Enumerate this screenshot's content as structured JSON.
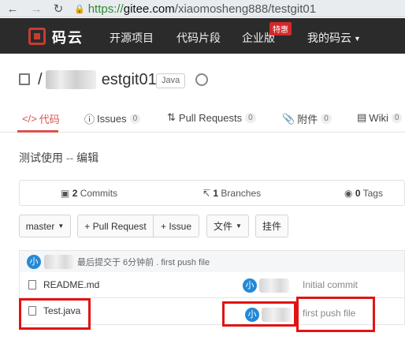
{
  "browser": {
    "url_secure": "https://",
    "url_host": "gitee.com",
    "url_path": "/xiaomosheng888/testgit01"
  },
  "header": {
    "brand": "码云",
    "nav": [
      "开源项目",
      "代码片段",
      "企业版",
      "我的码云"
    ],
    "hot_badge": "特惠"
  },
  "repo": {
    "name_visible": "estgit01",
    "name_prefix": "/",
    "language": "Java"
  },
  "tabs": [
    {
      "label": "代码",
      "icon": "code-icon"
    },
    {
      "label": "Issues",
      "count": "0",
      "icon": "issue-icon"
    },
    {
      "label": "Pull Requests",
      "count": "0",
      "icon": "pull-request-icon"
    },
    {
      "label": "附件",
      "count": "0",
      "icon": "attachment-icon"
    },
    {
      "label": "Wiki",
      "count": "0",
      "icon": "wiki-icon"
    }
  ],
  "description": {
    "text": "测试使用",
    "separator": " -- ",
    "edit": "编辑"
  },
  "stats": {
    "commits_num": "2",
    "commits_label": " Commits",
    "branches_num": "1",
    "branches_label": " Branches",
    "tags_num": "0",
    "tags_label": " Tags"
  },
  "actions": {
    "branch": "master",
    "pull_request": "+ Pull Request",
    "issue": "+ Issue",
    "files": "文件",
    "widgets": "挂件"
  },
  "latest_commit": {
    "avatar_letter": "小",
    "summary": "最后提交于 6分钟前 . first push file"
  },
  "files": [
    {
      "name": "README.md",
      "avatar_letter": "小",
      "message": "Initial commit"
    },
    {
      "name": "Test.java",
      "avatar_letter": "小",
      "message": "first push file"
    }
  ]
}
